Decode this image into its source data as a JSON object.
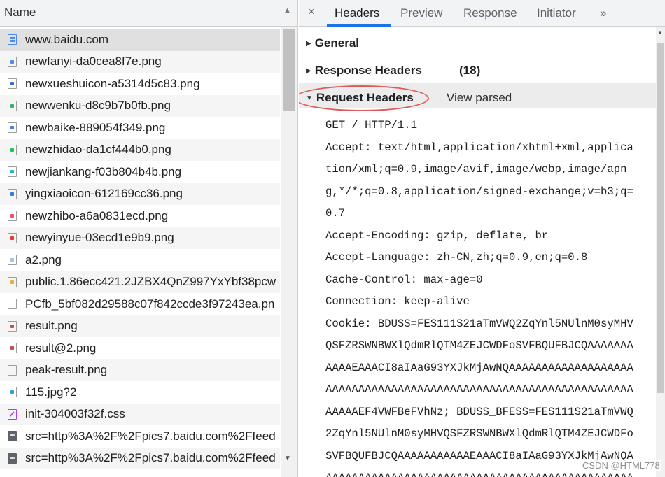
{
  "list": {
    "column_header": "Name",
    "items": [
      {
        "name": "www.baidu.com",
        "icon": "document-icon",
        "icon_color": "#4c8bf5"
      },
      {
        "name": "newfanyi-da0cea8f7e.png",
        "icon": "image-icon",
        "icon_color": "#4c8bf5"
      },
      {
        "name": "newxueshuicon-a5314d5c83.png",
        "icon": "image-icon",
        "icon_color": "#3b6fd4"
      },
      {
        "name": "newwenku-d8c9b7b0fb.png",
        "icon": "image-icon",
        "icon_color": "#2bb673"
      },
      {
        "name": "newbaike-889054f349.png",
        "icon": "image-icon",
        "icon_color": "#3b82f6"
      },
      {
        "name": "newzhidao-da1cf444b0.png",
        "icon": "image-icon",
        "icon_color": "#21c05a"
      },
      {
        "name": "newjiankang-f03b804b4b.png",
        "icon": "image-icon",
        "icon_color": "#23b5d3"
      },
      {
        "name": "yingxiaoicon-612169cc36.png",
        "icon": "image-icon",
        "icon_color": "#2f7de1"
      },
      {
        "name": "newzhibo-a6a0831ecd.png",
        "icon": "image-icon",
        "icon_color": "#f0506e"
      },
      {
        "name": "newyinyue-03ecd1e9b9.png",
        "icon": "image-icon",
        "icon_color": "#e53935"
      },
      {
        "name": "a2.png",
        "icon": "image-icon",
        "icon_color": "#9ec5f0"
      },
      {
        "name": "public.1.86ecc421.2JZBX4QnZ997YxYbf38pcw",
        "icon": "image-icon",
        "icon_color": "#e8b23a"
      },
      {
        "name": "PCfb_5bf082d29588c07f842ccde3f97243ea.pn",
        "icon": "blank-icon",
        "icon_color": "#cccccc"
      },
      {
        "name": "result.png",
        "icon": "image-icon",
        "icon_color": "#c0504d"
      },
      {
        "name": "result@2.png",
        "icon": "image-icon",
        "icon_color": "#c0504d"
      },
      {
        "name": "peak-result.png",
        "icon": "blank-icon",
        "icon_color": "#cccccc"
      },
      {
        "name": "115.jpg?2",
        "icon": "image-icon",
        "icon_color": "#3b9cd6"
      },
      {
        "name": "init-304003f32f.css",
        "icon": "css-icon",
        "icon_color": "#a142f4"
      },
      {
        "name": "src=http%3A%2F%2Fpics7.baidu.com%2Ffeed",
        "icon": "image-dark-icon",
        "icon_color": "#5f6368"
      },
      {
        "name": "src=http%3A%2F%2Fpics7.baidu.com%2Ffeed",
        "icon": "image-dark-icon",
        "icon_color": "#5f6368"
      }
    ]
  },
  "tabs": {
    "close": "×",
    "headers": "Headers",
    "preview": "Preview",
    "response": "Response",
    "initiator": "Initiator",
    "more": "»"
  },
  "sections": {
    "general": "General",
    "response_headers": "Response Headers",
    "response_count": "(18)",
    "request_headers": "Request Headers",
    "view_parsed": "View parsed"
  },
  "raw_request_lines": [
    "GET / HTTP/1.1",
    "Accept: text/html,application/xhtml+xml,applica",
    "tion/xml;q=0.9,image/avif,image/webp,image/apn",
    "g,*/*;q=0.8,application/signed-exchange;v=b3;q=",
    "0.7",
    "Accept-Encoding: gzip, deflate, br",
    "Accept-Language: zh-CN,zh;q=0.9,en;q=0.8",
    "Cache-Control: max-age=0",
    "Connection: keep-alive",
    "Cookie: BDUSS=FES111S21aTmVWQ2ZqYnl5NUlnM0syMHV",
    "QSFZRSWNBWXlQdmRlQTM4ZEJCWDFoSVFBQUFBJCQAAAAAAA",
    "AAAAEAAACI8aIAaG93YXJkMjAwNQAAAAAAAAAAAAAAAAAAA",
    "AAAAAAAAAAAAAAAAAAAAAAAAAAAAAAAAAAAAAAAAAAAAAAA",
    "AAAAAEF4VWFBeFVhNz; BDUSS_BFESS=FES111S21aTmVWQ",
    "2ZqYnl5NUlnM0syMHVQSFZRSWNBWXlQdmRlQTM4ZEJCWDFo",
    "SVFBQUFBJCQAAAAAAAAAAAEAAACI8aIAaG93YXJkMjAwNQA",
    "AAAAAAAAAAAAAAAAAAAAAAAAAAAAAAAAAAAAAAAAAAAAAAA"
  ],
  "watermark": "CSDN @HTML778"
}
